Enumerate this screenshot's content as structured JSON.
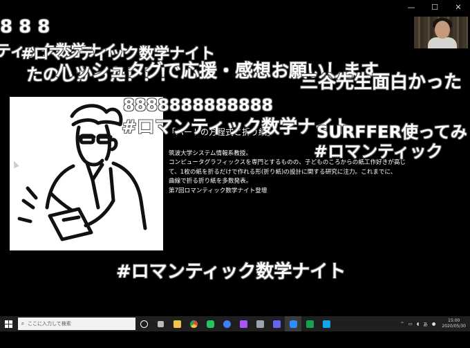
{
  "window": {
    "controls": [
      "—",
      "☐",
      "✕"
    ]
  },
  "slide": {
    "title": "「ハートの方程式と折り紙」",
    "ghost_top": "8888888888888",
    "bio_lines": [
      "筑波大学システム情報系教授。",
      "コンピュータグラフィックスを専門とするものの、子どものころからの紙工作好きが高じ",
      "て、1枚の紙を折るだけで作れる形(折り紙)の設計に関する研究に注力。これまでに、",
      "曲線で折る折り紙を多数発表。",
      "第7回ロマンティック数学ナイト登壇"
    ]
  },
  "comments": {
    "c1": "8 8 8",
    "c2": "ティック数学ナイト",
    "c3": "#ロマンティック数学ナイト",
    "c4": "たのしかった！！！",
    "c5": "ハッシュタグで応援・感想お願いします",
    "c6": "三谷先生面白かった",
    "c7": "8888888888888",
    "c8": "#ロマンティック数学ナイト",
    "c9": "SURFFER使ってみ",
    "c10": "#ロマンティック",
    "c11": "#ロマンティック数学ナイト"
  },
  "taskbar": {
    "search_placeholder": "ここに入力して検索",
    "time": "15:00",
    "date": "2020/05/30",
    "ime": "あ",
    "app_icons": [
      {
        "name": "task-view-icon",
        "color": "#ffffff"
      },
      {
        "name": "widgets-icon",
        "color": "#cccccc"
      },
      {
        "name": "explorer-icon",
        "color": "#f2c14e"
      },
      {
        "name": "chrome-icon",
        "color": "#e2453c"
      },
      {
        "name": "line-icon",
        "color": "#22c55e"
      },
      {
        "name": "edge-icon",
        "color": "#3b82f6"
      },
      {
        "name": "slack-icon",
        "color": "#a855f7"
      },
      {
        "name": "tool-icon",
        "color": "#9ca3af"
      },
      {
        "name": "teams-icon",
        "color": "#6366f1"
      },
      {
        "name": "zoom-icon",
        "color": "#2d8cff"
      },
      {
        "name": "excel-icon",
        "color": "#16a34a"
      },
      {
        "name": "app-icon",
        "color": "#0ea5e9"
      }
    ]
  }
}
